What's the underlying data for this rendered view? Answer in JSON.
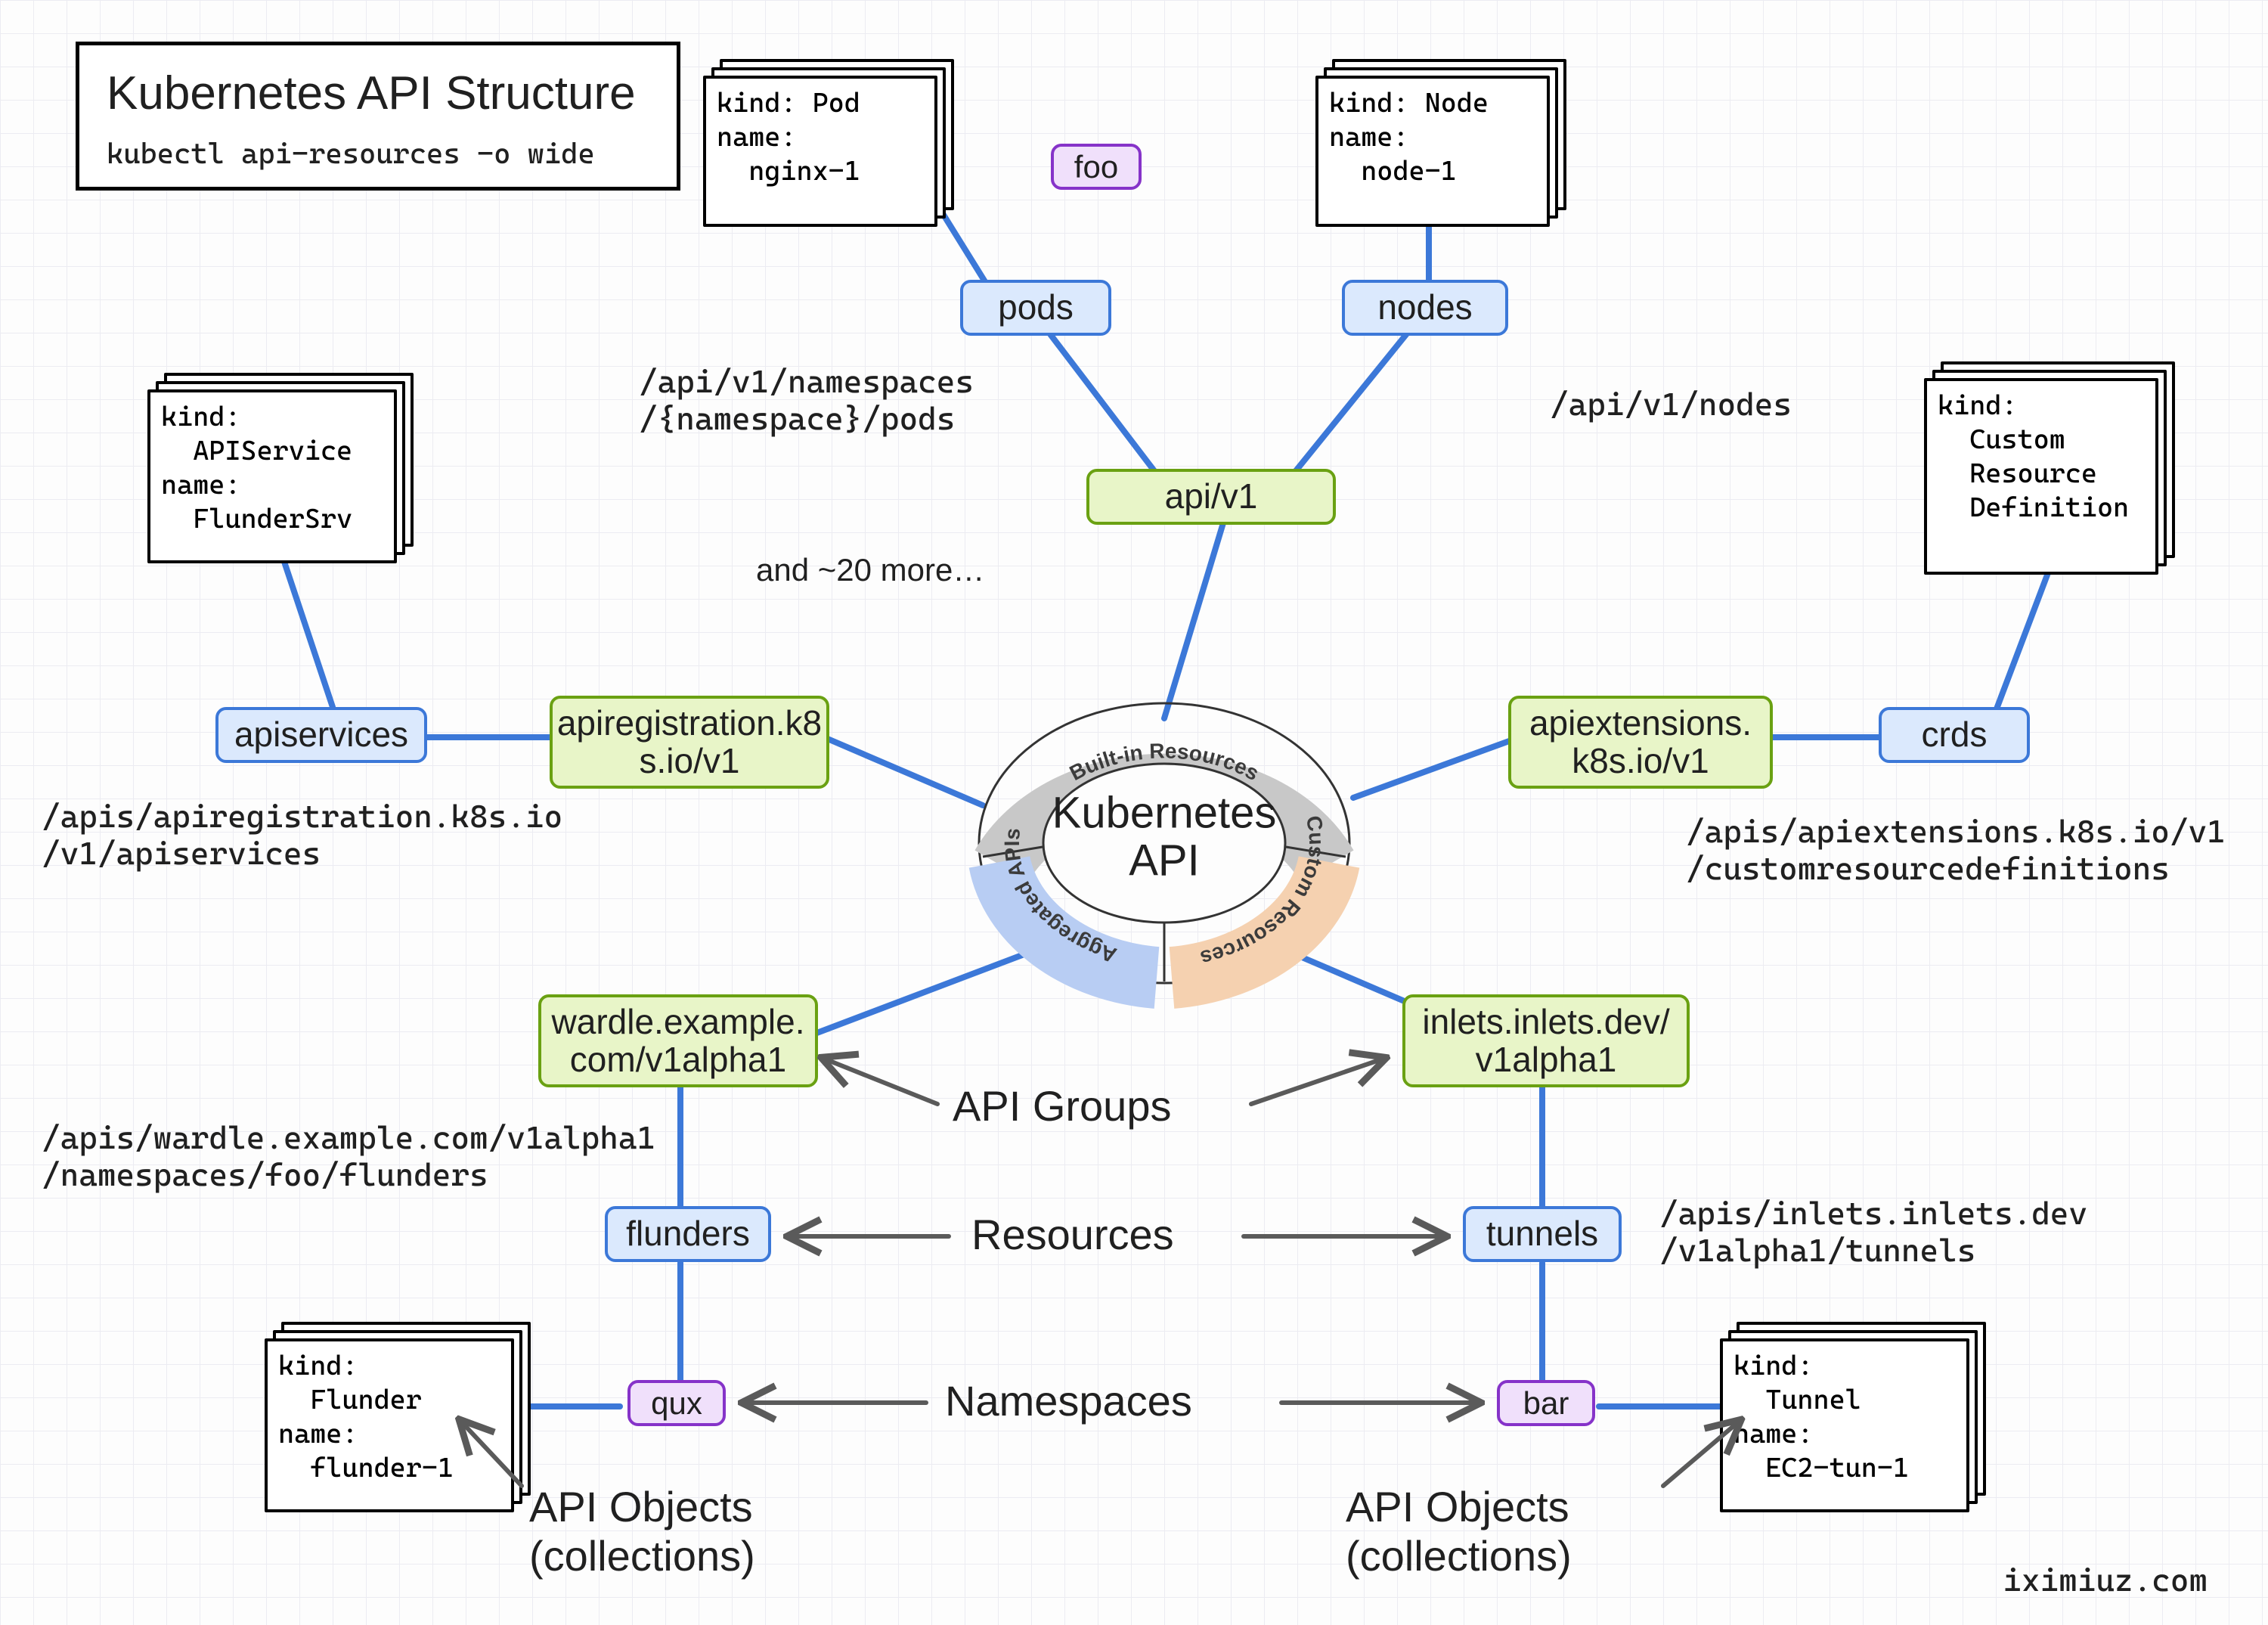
{
  "title": "Kubernetes API Structure",
  "command": "kubectl api-resources -o wide",
  "center": {
    "title": "Kubernetes\nAPI",
    "seg_builtin": "Built-in\nResources",
    "seg_aggregated": "Aggregated\nAPIs",
    "seg_custom": "Custom\nResources"
  },
  "groups": {
    "api_v1": "api/v1",
    "apiregistration": "apiregistration.k8\ns.io/v1",
    "apiextensions": "apiextensions.\nk8s.io/v1",
    "wardle": "wardle.example.\ncom/v1alpha1",
    "inlets": "inlets.inlets.dev/\nv1alpha1"
  },
  "resources": {
    "pods": "pods",
    "nodes": "nodes",
    "apiservices": "apiservices",
    "crds": "crds",
    "flunders": "flunders",
    "tunnels": "tunnels"
  },
  "namespaces": {
    "foo": "foo",
    "qux": "qux",
    "bar": "bar"
  },
  "docs": {
    "pod": "kind: Pod\nname:\n  nginx-1",
    "node": "kind: Node\nname:\n  node-1",
    "apiservice": "kind:\n  APIService\nname:\n  FlunderSrv",
    "crd": "kind:\n  Custom\n  Resource\n  Definition",
    "flunder": "kind:\n  Flunder\nname:\n  flunder-1",
    "tunnel": "kind:\n  Tunnel\nname:\n  EC2-tun-1"
  },
  "paths": {
    "pods": "/api/v1/namespaces\n/{namespace}/pods",
    "nodes": "/api/v1/nodes",
    "apiservices": "/apis/apiregistration.k8s.io\n/v1/apiservices",
    "crds": "/apis/apiextensions.k8s.io/v1\n/customresourcedefinitions",
    "flunders": "/apis/wardle.example.com/v1alpha1\n/namespaces/foo/flunders",
    "tunnels": "/apis/inlets.inlets.dev\n/v1alpha1/tunnels"
  },
  "annotations": {
    "and_more": "and ~20 more…",
    "api_groups": "API Groups",
    "resources": "Resources",
    "namespaces": "Namespaces",
    "api_objects_left": "API Objects\n(collections)",
    "api_objects_right": "API Objects\n(collections)"
  },
  "attribution": "iximiuz.com"
}
